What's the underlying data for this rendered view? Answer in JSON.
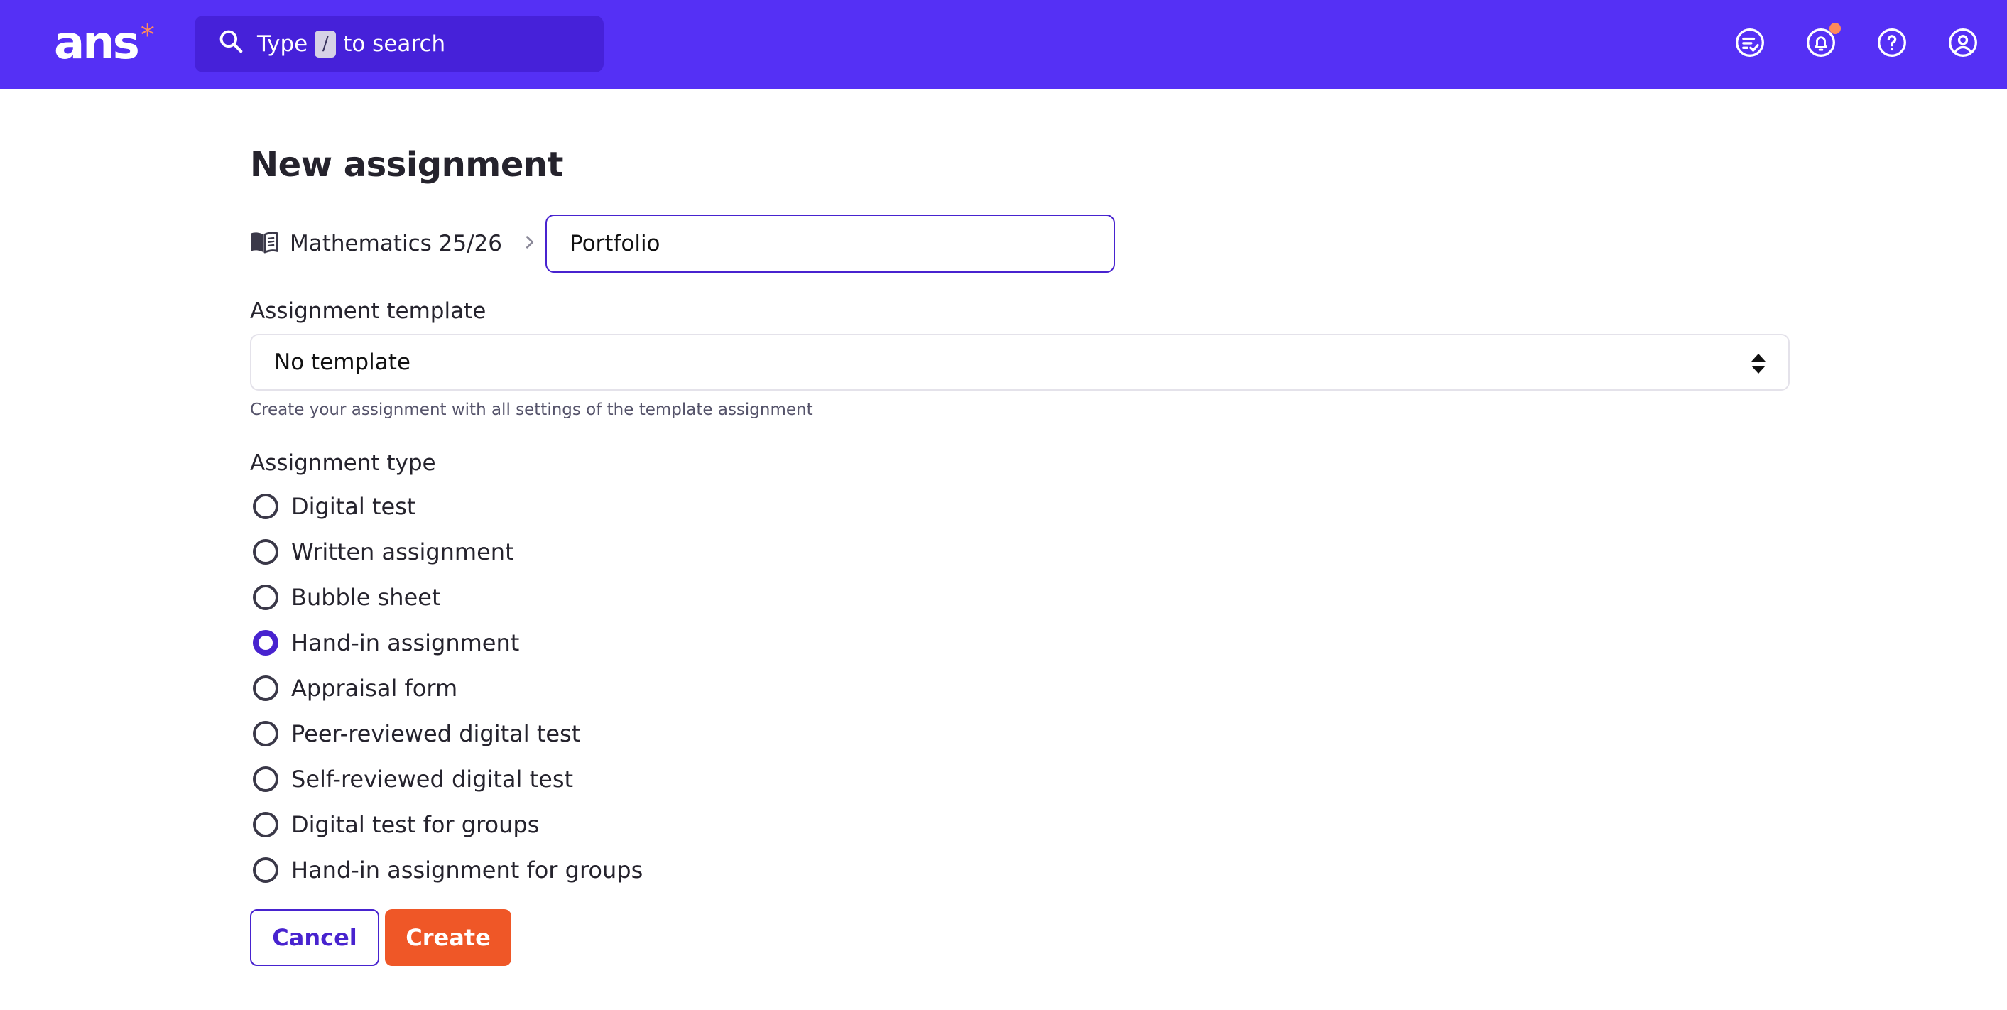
{
  "header": {
    "logo_text": "ans",
    "logo_mark": "*",
    "search": {
      "prefix": "Type",
      "key": "/",
      "suffix": "to search"
    },
    "icons": [
      "checklist-icon",
      "bell-icon",
      "help-icon",
      "account-icon"
    ]
  },
  "page": {
    "title": "New assignment",
    "breadcrumb": {
      "course": "Mathematics 25/26"
    },
    "name_value": "Portfolio",
    "template": {
      "label": "Assignment template",
      "selected": "No template",
      "helper": "Create your assignment with all settings of the template assignment"
    },
    "type": {
      "label": "Assignment type",
      "options": [
        {
          "label": "Digital test",
          "checked": false
        },
        {
          "label": "Written assignment",
          "checked": false
        },
        {
          "label": "Bubble sheet",
          "checked": false
        },
        {
          "label": "Hand-in assignment",
          "checked": true
        },
        {
          "label": "Appraisal form",
          "checked": false
        },
        {
          "label": "Peer-reviewed digital test",
          "checked": false
        },
        {
          "label": "Self-reviewed digital test",
          "checked": false
        },
        {
          "label": "Digital test for groups",
          "checked": false
        },
        {
          "label": "Hand-in assignment for groups",
          "checked": false
        }
      ]
    },
    "buttons": {
      "cancel": "Cancel",
      "create": "Create"
    }
  },
  "colors": {
    "brand": "#5530f5",
    "accent": "#ef5727",
    "primary": "#4823cf",
    "notification": "#ff8a5b"
  }
}
